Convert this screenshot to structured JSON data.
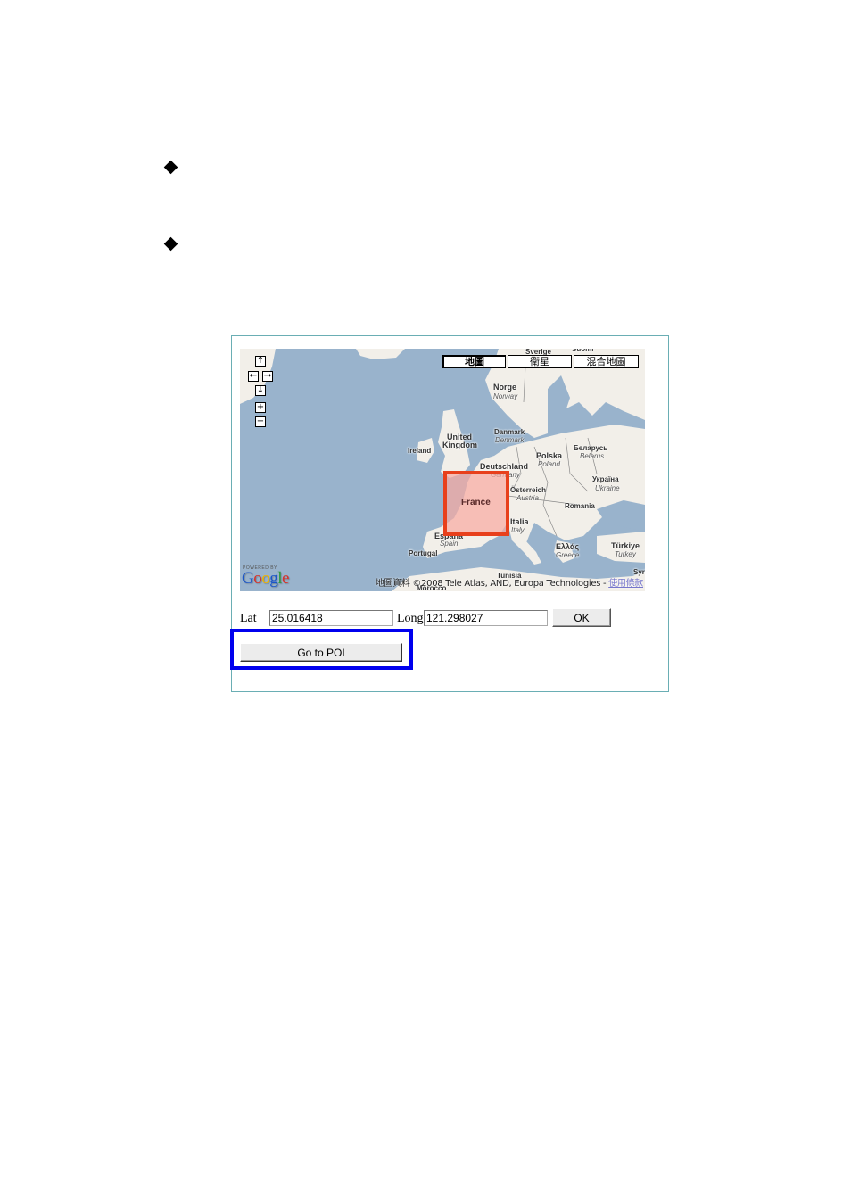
{
  "document": {
    "bullets": [
      {
        "icon": "diamond-bullet-icon",
        "text": ""
      },
      {
        "icon": "diamond-bullet-icon",
        "text": ""
      }
    ]
  },
  "map": {
    "nav_controls": {
      "pan_up": "↑",
      "pan_left": "←",
      "pan_right": "→",
      "pan_down": "↓",
      "zoom_in": "+",
      "zoom_out": "−"
    },
    "map_types": [
      {
        "label": "地圖",
        "active": true
      },
      {
        "label": "衛星",
        "active": false
      },
      {
        "label": "混合地圖",
        "active": false
      }
    ],
    "labels": {
      "sverige": "Sverige",
      "suomi": "Suomi",
      "norge": "Norge",
      "norway": "Norway",
      "ireland": "Ireland",
      "uk_line1": "United",
      "uk_line2": "Kingdom",
      "danmark": "Danmark",
      "denmark": "Denmark",
      "deutschland": "Deutschland",
      "germany": "Germany",
      "polska": "Polska",
      "poland": "Poland",
      "belarus_native": "Беларусь",
      "belarus": "Belarus",
      "ukraine_native": "Україна",
      "ukraine": "Ukraine",
      "osterreich": "Österreich",
      "austria": "Austria",
      "romania": "Romania",
      "italia": "Italia",
      "italy": "Italy",
      "espana": "España",
      "spain": "Spain",
      "portugal": "Portugal",
      "ellas": "Ελλάς",
      "greece": "Greece",
      "turkiye": "Türkiye",
      "turkey": "Turkey",
      "tunisia": "Tunisia",
      "morocco": "Morocco",
      "syria": "Syri"
    },
    "highlight_region": {
      "label": "France",
      "color": "#e8401c"
    },
    "powered_by": "POWERED BY",
    "logo": [
      "G",
      "o",
      "o",
      "g",
      "l",
      "e"
    ],
    "logo_colors": [
      "#1a55c9",
      "#d8322a",
      "#f0b400",
      "#1a55c9",
      "#2a9a3a",
      "#d8322a"
    ],
    "copyright": "地圖資料 ©2008 Tele Atlas, AND, Europa Technologies - ",
    "terms_link": "使用條款"
  },
  "form": {
    "lat_label": "Lat",
    "lat_value": "25.016418",
    "long_label": "Long",
    "long_value": "121.298027",
    "ok_label": "OK",
    "poi_label": "Go to POI",
    "highlight_color": "#0000ee"
  }
}
